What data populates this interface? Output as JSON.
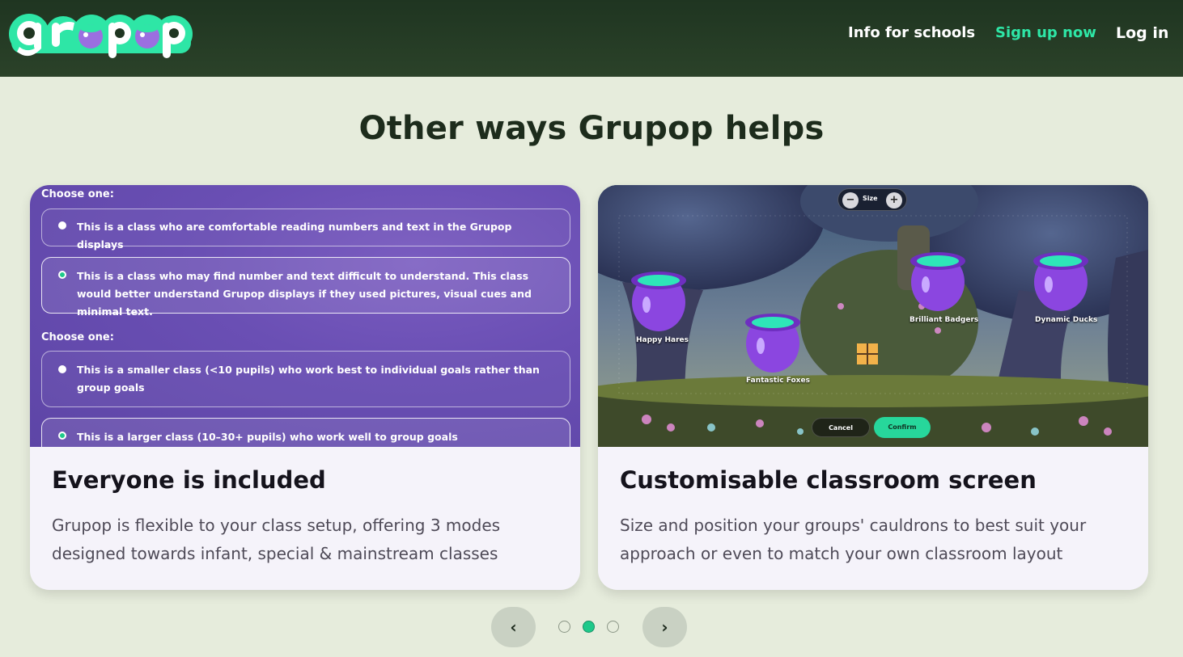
{
  "header": {
    "logo_alt": "grupop",
    "nav": {
      "schools": "Info for schools",
      "signup": "Sign up now",
      "login": "Log in"
    }
  },
  "section": {
    "title": "Other ways Grupop helps"
  },
  "cards": [
    {
      "title": "Everyone is included",
      "description": "Grupop is flexible to your class setup, offering 3 modes designed towards infant, special & mainstream classes",
      "media": {
        "choose_label_1": "Choose one:",
        "option_1": "This is a class who are comfortable reading numbers and text in the Grupop displays",
        "option_2": "This is a class who may find number and text difficult to understand. This class would better understand Grupop displays if they used pictures, visual cues and minimal text.",
        "choose_label_2": "Choose one:",
        "option_3": "This is a smaller class (<10 pupils) who work best to individual goals rather than group goals",
        "option_4": "This is a larger class (10–30+ pupils) who work well to group goals"
      }
    },
    {
      "title": "Customisable classroom screen",
      "description": "Size and position your groups' cauldrons to best suit your approach or even to match your own classroom layout",
      "media": {
        "size_label": "Size",
        "size_minus": "−",
        "size_plus": "+",
        "groups": [
          "Happy Hares",
          "Fantastic Foxes",
          "Brilliant Badgers",
          "Dynamic Ducks"
        ],
        "cancel": "Cancel",
        "confirm": "Confirm"
      }
    }
  ],
  "carousel": {
    "prev": "‹",
    "next": "›",
    "active_index": 1
  },
  "colors": {
    "header": "#233a24",
    "accent": "#2ee6a6",
    "background": "#e6ecdc",
    "card": "#f5f3fa"
  }
}
